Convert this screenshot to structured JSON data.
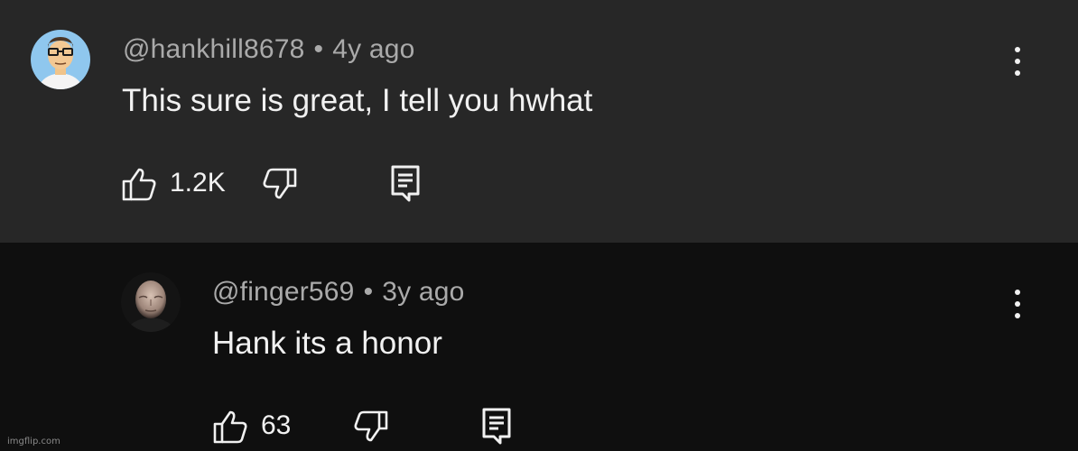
{
  "comments": [
    {
      "handle": "@hankhill8678",
      "separator": "•",
      "time": "4y ago",
      "text": "This sure is great, I tell you hwhat",
      "likes": "1.2K",
      "avatar": "cartoon-man-glasses"
    },
    {
      "handle": "@finger569",
      "separator": "•",
      "time": "3y ago",
      "text": "Hank its a honor",
      "likes": "63",
      "avatar": "bald-man-portrait"
    }
  ],
  "icons": {
    "like": "thumbs-up-icon",
    "dislike": "thumbs-down-icon",
    "reply": "reply-comment-icon",
    "menu": "more-vert-icon"
  },
  "colors": {
    "top_comment_bg": "#272727",
    "reply_bg": "#0f0f0f",
    "primary_text": "#f1f1f1",
    "secondary_text": "#aaaaaa"
  },
  "watermark": "imgflip.com"
}
